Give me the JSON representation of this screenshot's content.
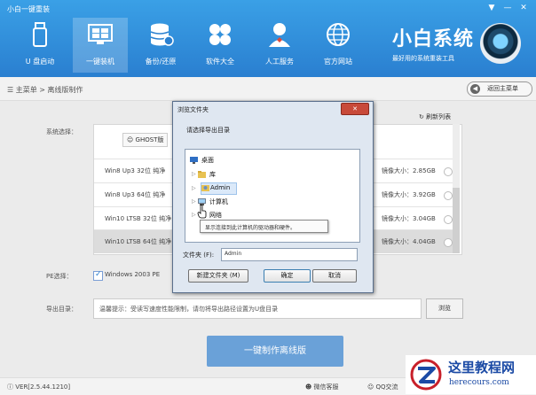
{
  "app": {
    "window_title": "小白一键重装",
    "window_controls": [
      "▼",
      "—",
      "✕"
    ]
  },
  "nav": {
    "items": [
      {
        "label": "U 盘启动",
        "icon": "usb-drive-icon"
      },
      {
        "label": "一键装机",
        "icon": "monitor-icon"
      },
      {
        "label": "备份/还原",
        "icon": "database-icon"
      },
      {
        "label": "软件大全",
        "icon": "apps-grid-icon"
      },
      {
        "label": "人工服务",
        "icon": "support-agent-icon"
      },
      {
        "label": "官方网站",
        "icon": "globe-icon"
      }
    ],
    "active_index": 1
  },
  "brand": {
    "name": "小白系统",
    "slogan": "最好用的系统重装工具"
  },
  "breadcrumb": {
    "text": "主菜单 > 离线版制作",
    "back_label": "返回主菜单"
  },
  "main": {
    "system_label": "系统选择：",
    "refresh_label": "刷新列表",
    "ghost_tab": "GHOST版",
    "rows": [
      {
        "name": "Win8 Up3 32位 纯净",
        "size": "镜像大小：2.85GB"
      },
      {
        "name": "Win8 Up3 64位 纯净",
        "size": "镜像大小：3.92GB"
      },
      {
        "name": "Win10 LTSB 32位 纯净",
        "size": "镜像大小：3.04GB"
      },
      {
        "name": "Win10 LTSB 64位 纯净",
        "size": "镜像大小：4.04GB"
      }
    ],
    "pe_label": "PE选择：",
    "pe_option": "Windows 2003 PE",
    "export_label": "导出目录：",
    "export_hint": "温馨提示：受读写速度性能限制，请勿将导出路径设置为U盘目录",
    "browse_label": "浏览",
    "make_button": "一键制作离线版"
  },
  "status": {
    "version": "VER[2.5.44.1210]",
    "wechat": "微信客服",
    "qq": "QQ交流"
  },
  "watermark": {
    "title": "这里教程网",
    "url": "herecours.com"
  },
  "dialog": {
    "title": "浏览文件夹",
    "close": "✕",
    "prompt": "请选择导出目录",
    "tree": [
      "桌面",
      "库",
      "Admin",
      "计算机",
      "网络"
    ],
    "tooltip": "显示连接到此计算机的驱动器和硬件。",
    "folder_label": "文件夹 (F):",
    "folder_value": "Admin",
    "new_folder": "新建文件夹 (M)",
    "ok": "确定",
    "cancel": "取消"
  },
  "colors": {
    "header": "#2a8be0",
    "accent": "#6aa1d8",
    "brand_blue": "#1b4aa5"
  }
}
